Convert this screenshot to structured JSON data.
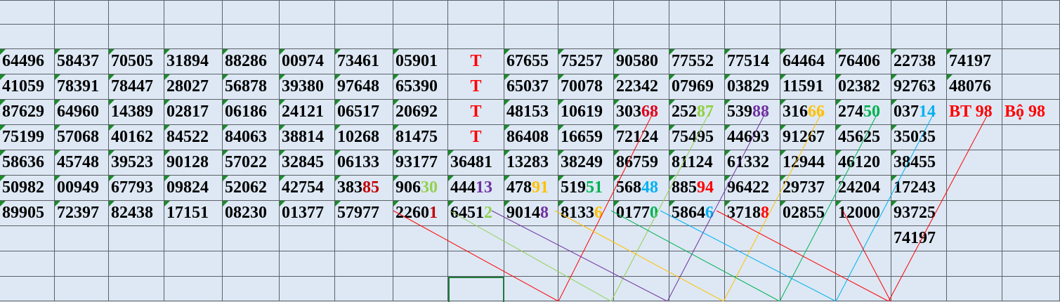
{
  "grid": {
    "rows": [
      [
        "64496",
        "58437",
        "70505",
        "31894",
        "88286",
        "00974",
        "73461",
        "05901",
        "T",
        "67655",
        "75257",
        "90580",
        "77552",
        "77514",
        "64464",
        "76406",
        "22738",
        "74197",
        "",
        ""
      ],
      [
        "41059",
        "78391",
        "78447",
        "28027",
        "56878",
        "39380",
        "97648",
        "65390",
        "T",
        "65037",
        "70078",
        "22342",
        "07969",
        "03829",
        "11591",
        "02382",
        "92763",
        "48076",
        "",
        ""
      ],
      [
        "87629",
        "64960",
        "14389",
        "02817",
        "06186",
        "24121",
        "06517",
        "20692",
        "T",
        "48153",
        "10619",
        "30368",
        "25287",
        "53988",
        "31666",
        "27450",
        "03714",
        "BT 98",
        "Bộ 98",
        ""
      ],
      [
        "75199",
        "57068",
        "40162",
        "84522",
        "84063",
        "38814",
        "10268",
        "81475",
        "T",
        "86408",
        "16659",
        "72124",
        "75495",
        "44693",
        "91267",
        "45625",
        "35035",
        "",
        "",
        ""
      ],
      [
        "58636",
        "45748",
        "39523",
        "90128",
        "57022",
        "32845",
        "06133",
        "93177",
        "36481",
        "13283",
        "38249",
        "86759",
        "81124",
        "61332",
        "12944",
        "46120",
        "38455",
        "",
        "",
        ""
      ],
      [
        "50982",
        "00949",
        "67793",
        "09824",
        "52062",
        "42754",
        "38385",
        "90630",
        "44413",
        "47891",
        "51951",
        "56848",
        "88594",
        "96422",
        "29737",
        "24204",
        "17243",
        "",
        "",
        ""
      ],
      [
        "89905",
        "72397",
        "82438",
        "17151",
        "08230",
        "01377",
        "57977",
        "22601",
        "64512",
        "90148",
        "81336",
        "01770",
        "58646",
        "37188",
        "02855",
        "12000",
        "93725",
        "",
        "",
        ""
      ],
      [
        "",
        "",
        "",
        "",
        "",
        "",
        "",
        "",
        "",
        "",
        "",
        "",
        "",
        "",
        "",
        "",
        "74197",
        "",
        "",
        ""
      ]
    ],
    "highlights": [
      {
        "row": 2,
        "col": 11,
        "digits": 2,
        "color": "#e0001b"
      },
      {
        "row": 2,
        "col": 12,
        "digits": 2,
        "color": "#8fcf3c"
      },
      {
        "row": 2,
        "col": 13,
        "digits": 2,
        "color": "#7030a0"
      },
      {
        "row": 2,
        "col": 14,
        "digits": 2,
        "color": "#ffc000"
      },
      {
        "row": 2,
        "col": 15,
        "digits": 2,
        "color": "#00b050"
      },
      {
        "row": 2,
        "col": 16,
        "digits": 2,
        "color": "#00b0f0"
      },
      {
        "row": 5,
        "col": 6,
        "digits": 2,
        "color": "#c00000"
      },
      {
        "row": 5,
        "col": 7,
        "digits": 2,
        "color": "#92d050"
      },
      {
        "row": 5,
        "col": 8,
        "digits": 2,
        "color": "#7030a0"
      },
      {
        "row": 5,
        "col": 9,
        "digits": 2,
        "color": "#ffc000"
      },
      {
        "row": 5,
        "col": 10,
        "digits": 2,
        "color": "#00b050"
      },
      {
        "row": 5,
        "col": 11,
        "digits": 2,
        "color": "#00b0f0"
      },
      {
        "row": 5,
        "col": 12,
        "digits": 2,
        "color": "#ff0000"
      },
      {
        "row": 6,
        "col": 7,
        "digits": 1,
        "color": "#c00000"
      },
      {
        "row": 6,
        "col": 8,
        "digits": 1,
        "color": "#92d050"
      },
      {
        "row": 6,
        "col": 9,
        "digits": 1,
        "color": "#7030a0"
      },
      {
        "row": 6,
        "col": 10,
        "digits": 1,
        "color": "#ffc000"
      },
      {
        "row": 6,
        "col": 11,
        "digits": 1,
        "color": "#00b050"
      },
      {
        "row": 6,
        "col": 12,
        "digits": 1,
        "color": "#00b0f0"
      },
      {
        "row": 6,
        "col": 13,
        "digits": 1,
        "color": "#ff0000"
      }
    ],
    "red_text_color": "#ff0000",
    "line_colors": [
      "#ff0000",
      "#92d050",
      "#7030a0",
      "#ffc000",
      "#00b050",
      "#00b0f0",
      "#ff0000"
    ]
  }
}
